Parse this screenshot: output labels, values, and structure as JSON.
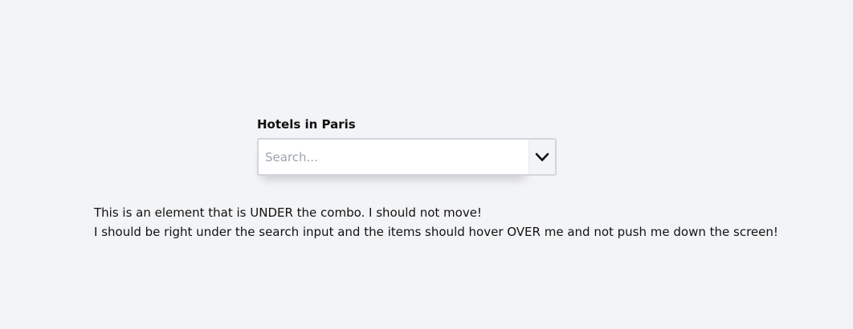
{
  "combo": {
    "label": "Hotels in Paris",
    "placeholder": "Search...",
    "value": "",
    "toggle_icon": "chevron-down-icon"
  },
  "under_element": {
    "line1": "This is an element that is UNDER the combo. I should not move!",
    "line2": "I should be right under the search input and the items should hover OVER me and not push me down the screen!"
  }
}
